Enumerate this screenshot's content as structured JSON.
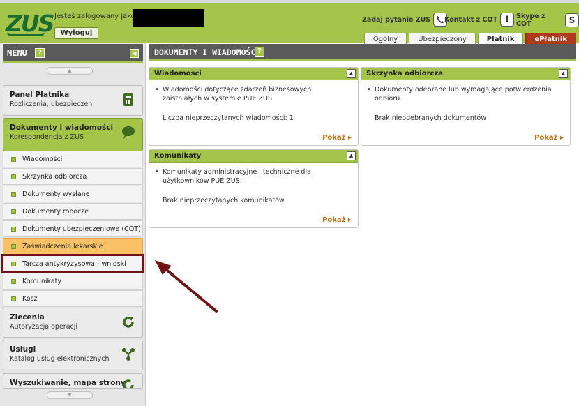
{
  "header": {
    "logo_text": "ZUS",
    "logged_in_label": "Jesteś zalogowany jako:",
    "logout_label": "Wyloguj",
    "links": [
      {
        "label": "Zadaj pytanie ZUS",
        "icon": "phone-icon"
      },
      {
        "label": "Kontakt z COT",
        "icon": "info-icon"
      },
      {
        "label": "Skype z COT",
        "icon": "skype-icon"
      }
    ],
    "tabs": [
      {
        "label": "Ogólny"
      },
      {
        "label": "Ubezpieczony"
      },
      {
        "label": "Płatnik"
      },
      {
        "label": "ePłatnik"
      }
    ]
  },
  "sidebar": {
    "menu_title": "MENU",
    "help_glyph": "?",
    "panels": {
      "panel_platnika": {
        "title": "Panel Płatnika",
        "subtitle": "Rozliczenia, ubezpieczeni"
      },
      "dokumenty": {
        "title": "Dokumenty i wiadomości",
        "subtitle": "Korespondencja z ZUS"
      },
      "zlecenia": {
        "title": "Zlecenia",
        "subtitle": "Autoryzacja operacji"
      },
      "uslugi": {
        "title": "Usługi",
        "subtitle": "Katalog usług elektronicznych"
      },
      "wyszukiwanie": {
        "title": "Wyszukiwanie, mapa strony"
      }
    },
    "items": [
      {
        "label": "Wiadomości"
      },
      {
        "label": "Skrzynka odbiorcza"
      },
      {
        "label": "Dokumenty wysłane"
      },
      {
        "label": "Dokumenty robocze"
      },
      {
        "label": "Dokumenty ubezpieczeniowe (COT)"
      },
      {
        "label": "Zaświadczenia lekarskie"
      },
      {
        "label": "Tarcza antykryzysowa - wnioski"
      },
      {
        "label": "Komunikaty"
      },
      {
        "label": "Kosz"
      }
    ]
  },
  "main": {
    "title": "DOKUMENTY I WIADOMOŚCI",
    "help_glyph": "?",
    "boxes": {
      "wiadomosci": {
        "title": "Wiadomości",
        "description": "Wiadomości dotyczące zdarzeń biznesowych zaistniałych w systemie PUE ZUS.",
        "info": "Liczba nieprzeczytanych wiadomości: 1",
        "link": "Pokaż"
      },
      "skrzynka": {
        "title": "Skrzynka odbiorcza",
        "description": "Dokumenty odebrane lub wymagające potwierdzenia odbioru.",
        "info": "Brak nieodebranych dokumentów",
        "link": "Pokaż"
      },
      "komunikaty": {
        "title": "Komunikaty",
        "description": "Komunikaty administracyjne i techniczne dla użytkowników PUE ZUS.",
        "info": "Brak nieprzeczytanych komunikatów",
        "link": "Pokaż"
      }
    }
  },
  "colors": {
    "brand_green": "#a4c44a",
    "dark_green": "#1d6b2e",
    "highlight_orange": "#fbc167",
    "annotation_red": "#6e1414"
  }
}
